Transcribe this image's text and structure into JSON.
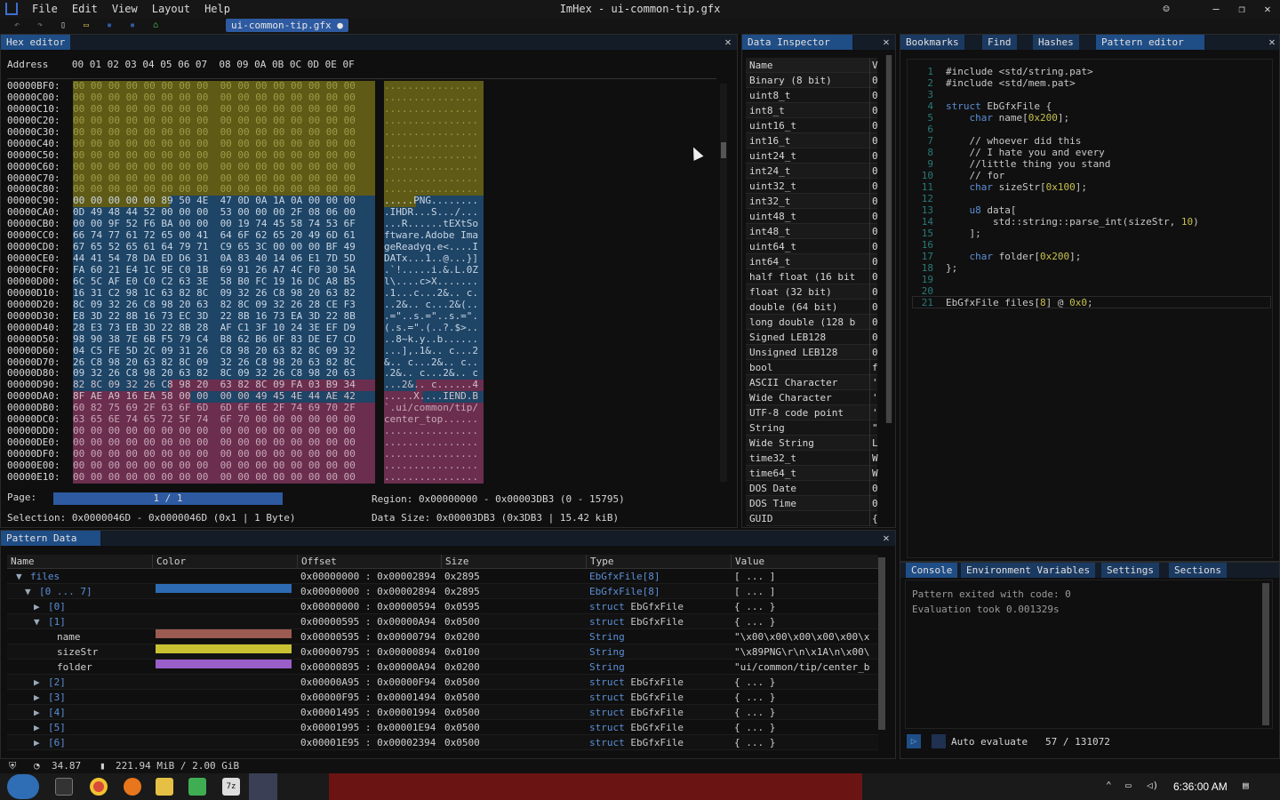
{
  "window": {
    "title": "ImHex - ui-common-tip.gfx",
    "menu": [
      "File",
      "Edit",
      "View",
      "Layout",
      "Help"
    ],
    "file_tab": "ui-common-tip.gfx ●",
    "controls": [
      "☺",
      "—",
      "❐",
      "✕"
    ]
  },
  "hex_editor": {
    "tab": "Hex editor",
    "header_address": "Address",
    "header_bytes": "00 01 02 03 04 05 06 07  08 09 0A 0B 0C 0D 0E 0F",
    "rows": [
      {
        "addr": "00000BF0:",
        "bytes": "00 00 00 00 00 00 00 00  00 00 00 00 00 00 00 00",
        "ascii": "................",
        "style": "y"
      },
      {
        "addr": "00000C00:",
        "bytes": "00 00 00 00 00 00 00 00  00 00 00 00 00 00 00 00",
        "ascii": "................",
        "style": "y"
      },
      {
        "addr": "00000C10:",
        "bytes": "00 00 00 00 00 00 00 00  00 00 00 00 00 00 00 00",
        "ascii": "................",
        "style": "y"
      },
      {
        "addr": "00000C20:",
        "bytes": "00 00 00 00 00 00 00 00  00 00 00 00 00 00 00 00",
        "ascii": "................",
        "style": "y"
      },
      {
        "addr": "00000C30:",
        "bytes": "00 00 00 00 00 00 00 00  00 00 00 00 00 00 00 00",
        "ascii": "................",
        "style": "y"
      },
      {
        "addr": "00000C40:",
        "bytes": "00 00 00 00 00 00 00 00  00 00 00 00 00 00 00 00",
        "ascii": "................",
        "style": "y"
      },
      {
        "addr": "00000C50:",
        "bytes": "00 00 00 00 00 00 00 00  00 00 00 00 00 00 00 00",
        "ascii": "................",
        "style": "y"
      },
      {
        "addr": "00000C60:",
        "bytes": "00 00 00 00 00 00 00 00  00 00 00 00 00 00 00 00",
        "ascii": "................",
        "style": "y"
      },
      {
        "addr": "00000C70:",
        "bytes": "00 00 00 00 00 00 00 00  00 00 00 00 00 00 00 00",
        "ascii": "................",
        "style": "y"
      },
      {
        "addr": "00000C80:",
        "bytes": "00 00 00 00 00 00 00 00  00 00 00 00 00 00 00 00",
        "ascii": "................",
        "style": "y"
      },
      {
        "addr": "00000C90:",
        "bytes": "00 00 00 00 00 89 50 4E  47 0D 0A 1A 0A 00 00 00",
        "ascii": ".....PNG........",
        "style": "yb"
      },
      {
        "addr": "00000CA0:",
        "bytes": "0D 49 48 44 52 00 00 00  53 00 00 00 2F 08 06 00",
        "ascii": ".IHDR...S.../...",
        "style": "b"
      },
      {
        "addr": "00000CB0:",
        "bytes": "00 00 9F 52 F6 BA 00 00  00 19 74 45 58 74 53 6F",
        "ascii": "...R......tEXtSo",
        "style": "b"
      },
      {
        "addr": "00000CC0:",
        "bytes": "66 74 77 61 72 65 00 41  64 6F 62 65 20 49 6D 61",
        "ascii": "ftware.Adobe Ima",
        "style": "b"
      },
      {
        "addr": "00000CD0:",
        "bytes": "67 65 52 65 61 64 79 71  C9 65 3C 00 00 00 BF 49",
        "ascii": "geReadyq.e<....I",
        "style": "b"
      },
      {
        "addr": "00000CE0:",
        "bytes": "44 41 54 78 DA ED D6 31  0A 83 40 14 06 E1 7D 5D",
        "ascii": "DATx...1..@...}]",
        "style": "b"
      },
      {
        "addr": "00000CF0:",
        "bytes": "FA 60 21 E4 1C 9E C0 1B  69 91 26 A7 4C F0 30 5A",
        "ascii": ".`!.....i.&.L.0Z",
        "style": "b"
      },
      {
        "addr": "00000D00:",
        "bytes": "6C 5C AF E0 C0 C2 63 3E  58 B0 FC 19 16 DC A8 B5",
        "ascii": "l\\....c>X.......",
        "style": "b"
      },
      {
        "addr": "00000D10:",
        "bytes": "16 31 C2 98 1C 63 82 8C  09 32 26 C8 98 20 63 82",
        "ascii": ".1...c...2&.. c.",
        "style": "b"
      },
      {
        "addr": "00000D20:",
        "bytes": "8C 09 32 26 C8 98 20 63  82 8C 09 32 26 28 CE F3",
        "ascii": "..2&.. c...2&(..",
        "style": "b"
      },
      {
        "addr": "00000D30:",
        "bytes": "E8 3D 22 8B 16 73 EC 3D  22 8B 16 73 EA 3D 22 8B",
        "ascii": ".=\"..s.=\"..s.=\".",
        "style": "b"
      },
      {
        "addr": "00000D40:",
        "bytes": "28 E3 73 EB 3D 22 8B 28  AF C1 3F 10 24 3E EF D9",
        "ascii": "(.s.=\".(..?.$>..",
        "style": "b"
      },
      {
        "addr": "00000D50:",
        "bytes": "98 90 38 7E 6B F5 79 C4  B8 62 B6 0F 83 DE E7 CD",
        "ascii": "..8~k.y..b......",
        "style": "b"
      },
      {
        "addr": "00000D60:",
        "bytes": "04 C5 FE 5D 2C 09 31 26  C8 98 20 63 82 8C 09 32",
        "ascii": "...],.1&.. c...2",
        "style": "b"
      },
      {
        "addr": "00000D70:",
        "bytes": "26 C8 98 20 63 82 8C 09  32 26 C8 98 20 63 82 8C",
        "ascii": "&.. c...2&.. c..",
        "style": "b"
      },
      {
        "addr": "00000D80:",
        "bytes": "09 32 26 C8 98 20 63 82  8C 09 32 26 C8 98 20 63",
        "ascii": ".2&.. c...2&.. c",
        "style": "b"
      },
      {
        "addr": "00000D90:",
        "bytes": "82 8C 09 32 26 C8 98 20  63 82 8C 09 FA 03 B9 34",
        "ascii": "...2&.. c......4",
        "style": "bp"
      },
      {
        "addr": "00000DA0:",
        "bytes": "8F AE A9 16 EA 58 00 00  00 00 49 45 4E 44 AE 42",
        "ascii": ".....X....IEND.B",
        "style": "bp2"
      },
      {
        "addr": "00000DB0:",
        "bytes": "60 82 75 69 2F 63 6F 6D  6D 6F 6E 2F 74 69 70 2F",
        "ascii": "`.ui/common/tip/",
        "style": "p"
      },
      {
        "addr": "00000DC0:",
        "bytes": "63 65 6E 74 65 72 5F 74  6F 70 00 00 00 00 00 00",
        "ascii": "center_top......",
        "style": "p"
      },
      {
        "addr": "00000DD0:",
        "bytes": "00 00 00 00 00 00 00 00  00 00 00 00 00 00 00 00",
        "ascii": "................",
        "style": "p"
      },
      {
        "addr": "00000DE0:",
        "bytes": "00 00 00 00 00 00 00 00  00 00 00 00 00 00 00 00",
        "ascii": "................",
        "style": "p"
      },
      {
        "addr": "00000DF0:",
        "bytes": "00 00 00 00 00 00 00 00  00 00 00 00 00 00 00 00",
        "ascii": "................",
        "style": "p"
      },
      {
        "addr": "00000E00:",
        "bytes": "00 00 00 00 00 00 00 00  00 00 00 00 00 00 00 00",
        "ascii": "................",
        "style": "p"
      },
      {
        "addr": "00000E10:",
        "bytes": "00 00 00 00 00 00 00 00  00 00 00 00 00 00 00 00",
        "ascii": "................",
        "style": "p"
      }
    ],
    "page_label": "Page:",
    "page_value": "1 / 1",
    "region": "Region: 0x00000000 - 0x00003DB3 (0 - 15795)",
    "selection": "Selection: 0x0000046D - 0x0000046D (0x1 | 1 Byte)",
    "data_size": "Data Size: 0x00003DB3 (0x3DB3 | 15.42 kiB)"
  },
  "data_inspector": {
    "tab": "Data Inspector",
    "header_name": "Name",
    "header_value": "V",
    "rows": [
      {
        "name": "Binary (8 bit)",
        "value": "0"
      },
      {
        "name": "uint8_t",
        "value": "0"
      },
      {
        "name": "int8_t",
        "value": "0"
      },
      {
        "name": "uint16_t",
        "value": "0"
      },
      {
        "name": "int16_t",
        "value": "0"
      },
      {
        "name": "uint24_t",
        "value": "0"
      },
      {
        "name": "int24_t",
        "value": "0"
      },
      {
        "name": "uint32_t",
        "value": "0"
      },
      {
        "name": "int32_t",
        "value": "0"
      },
      {
        "name": "uint48_t",
        "value": "0"
      },
      {
        "name": "int48_t",
        "value": "0"
      },
      {
        "name": "uint64_t",
        "value": "0"
      },
      {
        "name": "int64_t",
        "value": "0"
      },
      {
        "name": "half float (16 bit",
        "value": "0"
      },
      {
        "name": "float (32 bit)",
        "value": "0"
      },
      {
        "name": "double (64 bit)",
        "value": "0"
      },
      {
        "name": "long double (128 b",
        "value": "0"
      },
      {
        "name": "Signed LEB128",
        "value": "0"
      },
      {
        "name": "Unsigned LEB128",
        "value": "0"
      },
      {
        "name": "bool",
        "value": "f"
      },
      {
        "name": "ASCII Character",
        "value": "'"
      },
      {
        "name": "Wide Character",
        "value": "'"
      },
      {
        "name": "UTF-8 code point",
        "value": "'"
      },
      {
        "name": "String",
        "value": "\""
      },
      {
        "name": "Wide String",
        "value": "L"
      },
      {
        "name": "time32_t",
        "value": "W"
      },
      {
        "name": "time64_t",
        "value": "W"
      },
      {
        "name": "DOS Date",
        "value": "0"
      },
      {
        "name": "DOS Time",
        "value": "0"
      },
      {
        "name": "GUID",
        "value": "{"
      }
    ]
  },
  "right_tabs": [
    "Bookmarks",
    "Find",
    "Hashes",
    "Pattern editor"
  ],
  "pattern_editor": {
    "lines": [
      "#include <std/string.pat>",
      "#include <std/mem.pat>",
      "",
      "struct EbGfxFile {",
      "    char name[0x200];",
      "",
      "    // whoever did this",
      "    // I hate you and every",
      "    //little thing you stand",
      "    // for",
      "    char sizeStr[0x100];",
      "",
      "    u8 data[",
      "        std::string::parse_int(sizeStr, 10)",
      "    ];",
      "",
      "    char folder[0x200];",
      "};",
      "",
      "",
      "EbGfxFile files[8] @ 0x0;"
    ]
  },
  "pattern_data": {
    "tab": "Pattern Data",
    "columns": [
      "Name",
      "Color",
      "Offset",
      "Size",
      "Type",
      "Value"
    ],
    "rows": [
      {
        "indent": 1,
        "arrow": "▼",
        "name": "files",
        "color": "",
        "offset": "0x00000000 : 0x00002894",
        "size": "0x2895",
        "type_kw": "EbGfxFile[8]",
        "type_name": "",
        "value": "[ ... ]"
      },
      {
        "indent": 2,
        "arrow": "▼",
        "name": "[0 ... 7]",
        "color": "#2d6cb5",
        "offset": "0x00000000 : 0x00002894",
        "size": "0x2895",
        "type_kw": "EbGfxFile[8]",
        "type_name": "",
        "value": "[ ... ]"
      },
      {
        "indent": 3,
        "arrow": "▶",
        "name": "[0]",
        "color": "",
        "offset": "0x00000000 : 0x00000594",
        "size": "0x0595",
        "type_kw": "struct",
        "type_name": "EbGfxFile",
        "value": "{ ... }"
      },
      {
        "indent": 3,
        "arrow": "▼",
        "name": "[1]",
        "color": "",
        "offset": "0x00000595 : 0x00000A94",
        "size": "0x0500",
        "type_kw": "struct",
        "type_name": "EbGfxFile",
        "value": "{ ... }"
      },
      {
        "indent": 4,
        "arrow": "",
        "name": "name",
        "color": "#9b5a52",
        "offset": "0x00000595 : 0x00000794",
        "size": "0x0200",
        "type_kw": "String",
        "type_name": "",
        "value": "\"\\x00\\x00\\x00\\x00\\x00\\x"
      },
      {
        "indent": 4,
        "arrow": "",
        "name": "sizeStr",
        "color": "#c8c232",
        "offset": "0x00000795 : 0x00000894",
        "size": "0x0100",
        "type_kw": "String",
        "type_name": "",
        "value": "\"\\x89PNG\\r\\n\\x1A\\n\\x00\\"
      },
      {
        "indent": 4,
        "arrow": "",
        "name": "folder",
        "color": "#9b5ec8",
        "offset": "0x00000895 : 0x00000A94",
        "size": "0x0200",
        "type_kw": "String",
        "type_name": "",
        "value": "\"ui/common/tip/center_b"
      },
      {
        "indent": 3,
        "arrow": "▶",
        "name": "[2]",
        "color": "",
        "offset": "0x00000A95 : 0x00000F94",
        "size": "0x0500",
        "type_kw": "struct",
        "type_name": "EbGfxFile",
        "value": "{ ... }"
      },
      {
        "indent": 3,
        "arrow": "▶",
        "name": "[3]",
        "color": "",
        "offset": "0x00000F95 : 0x00001494",
        "size": "0x0500",
        "type_kw": "struct",
        "type_name": "EbGfxFile",
        "value": "{ ... }"
      },
      {
        "indent": 3,
        "arrow": "▶",
        "name": "[4]",
        "color": "",
        "offset": "0x00001495 : 0x00001994",
        "size": "0x0500",
        "type_kw": "struct",
        "type_name": "EbGfxFile",
        "value": "{ ... }"
      },
      {
        "indent": 3,
        "arrow": "▶",
        "name": "[5]",
        "color": "",
        "offset": "0x00001995 : 0x00001E94",
        "size": "0x0500",
        "type_kw": "struct",
        "type_name": "EbGfxFile",
        "value": "{ ... }"
      },
      {
        "indent": 3,
        "arrow": "▶",
        "name": "[6]",
        "color": "",
        "offset": "0x00001E95 : 0x00002394",
        "size": "0x0500",
        "type_kw": "struct",
        "type_name": "EbGfxFile",
        "value": "{ ... }"
      }
    ]
  },
  "console": {
    "tabs": [
      "Console",
      "Environment Variables",
      "Settings",
      "Sections"
    ],
    "lines": [
      "Pattern exited with code: 0",
      "Evaluation took 0.001329s"
    ],
    "auto_evaluate": "Auto evaluate",
    "position": "57 / 131072"
  },
  "status": {
    "fps": "34.87",
    "memory": "221.94 MiB / 2.00 GiB"
  },
  "taskbar": {
    "time": "6:36:00 AM"
  },
  "colors": {
    "accent": "#2d5aa0",
    "hex_yellow": "#5f5b16",
    "hex_blue": "#1e4466",
    "hex_pink": "#6b2e4e"
  }
}
